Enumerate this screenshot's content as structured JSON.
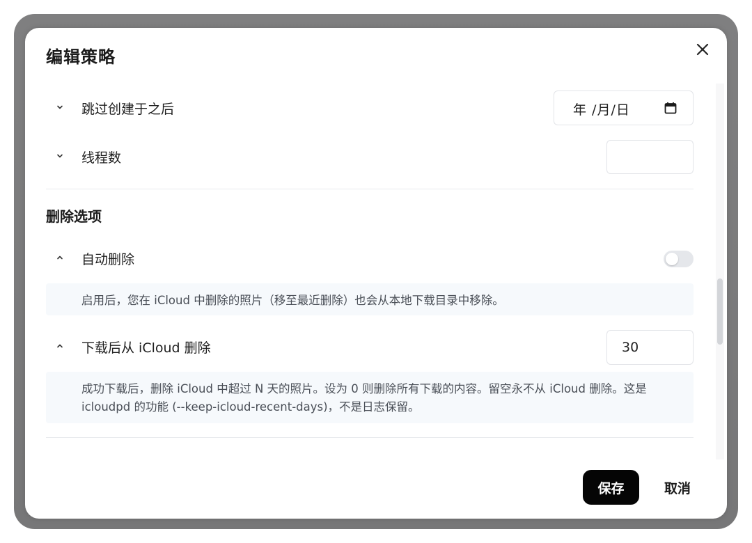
{
  "dialog": {
    "title": "编辑策略",
    "close_icon": "close-icon"
  },
  "rows": {
    "skip_created_after": {
      "label": "跳过创建于之后",
      "chevron": "chevron-down-icon",
      "date_placeholder": "年 /月/日",
      "calendar_icon": "calendar-icon"
    },
    "threads": {
      "label": "线程数",
      "chevron": "chevron-down-icon",
      "value": ""
    }
  },
  "delete_section": {
    "title": "删除选项",
    "auto_delete": {
      "label": "自动删除",
      "chevron": "chevron-up-icon",
      "enabled": false,
      "description": "启用后，您在 iCloud 中删除的照片（移至最近删除）也会从本地下载目录中移除。"
    },
    "delete_after_download": {
      "label": "下载后从 iCloud 删除",
      "chevron": "chevron-up-icon",
      "value": "30",
      "description": "成功下载后，删除 iCloud 中超过 N 天的照片。设为 0 则删除所有下载的内容。留空永不从 iCloud 删除。这是 icloudpd 的功能 (--keep-icloud-recent-days)，不是日志保留。"
    }
  },
  "footer": {
    "save_label": "保存",
    "cancel_label": "取消"
  },
  "colors": {
    "primary_button": "#050505",
    "description_bg": "#f6f9fc",
    "toggle_off": "#e5e7eb"
  }
}
